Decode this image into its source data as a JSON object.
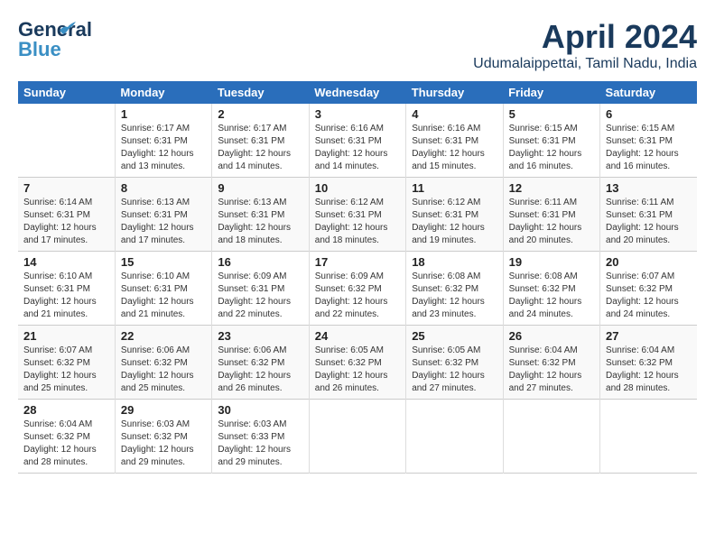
{
  "header": {
    "logo_general": "General",
    "logo_blue": "Blue",
    "month_title": "April 2024",
    "location": "Udumalaippettai, Tamil Nadu, India"
  },
  "weekdays": [
    "Sunday",
    "Monday",
    "Tuesday",
    "Wednesday",
    "Thursday",
    "Friday",
    "Saturday"
  ],
  "weeks": [
    [
      {
        "day": "",
        "info": ""
      },
      {
        "day": "1",
        "info": "Sunrise: 6:17 AM\nSunset: 6:31 PM\nDaylight: 12 hours\nand 13 minutes."
      },
      {
        "day": "2",
        "info": "Sunrise: 6:17 AM\nSunset: 6:31 PM\nDaylight: 12 hours\nand 14 minutes."
      },
      {
        "day": "3",
        "info": "Sunrise: 6:16 AM\nSunset: 6:31 PM\nDaylight: 12 hours\nand 14 minutes."
      },
      {
        "day": "4",
        "info": "Sunrise: 6:16 AM\nSunset: 6:31 PM\nDaylight: 12 hours\nand 15 minutes."
      },
      {
        "day": "5",
        "info": "Sunrise: 6:15 AM\nSunset: 6:31 PM\nDaylight: 12 hours\nand 16 minutes."
      },
      {
        "day": "6",
        "info": "Sunrise: 6:15 AM\nSunset: 6:31 PM\nDaylight: 12 hours\nand 16 minutes."
      }
    ],
    [
      {
        "day": "7",
        "info": "Sunrise: 6:14 AM\nSunset: 6:31 PM\nDaylight: 12 hours\nand 17 minutes."
      },
      {
        "day": "8",
        "info": "Sunrise: 6:13 AM\nSunset: 6:31 PM\nDaylight: 12 hours\nand 17 minutes."
      },
      {
        "day": "9",
        "info": "Sunrise: 6:13 AM\nSunset: 6:31 PM\nDaylight: 12 hours\nand 18 minutes."
      },
      {
        "day": "10",
        "info": "Sunrise: 6:12 AM\nSunset: 6:31 PM\nDaylight: 12 hours\nand 18 minutes."
      },
      {
        "day": "11",
        "info": "Sunrise: 6:12 AM\nSunset: 6:31 PM\nDaylight: 12 hours\nand 19 minutes."
      },
      {
        "day": "12",
        "info": "Sunrise: 6:11 AM\nSunset: 6:31 PM\nDaylight: 12 hours\nand 20 minutes."
      },
      {
        "day": "13",
        "info": "Sunrise: 6:11 AM\nSunset: 6:31 PM\nDaylight: 12 hours\nand 20 minutes."
      }
    ],
    [
      {
        "day": "14",
        "info": "Sunrise: 6:10 AM\nSunset: 6:31 PM\nDaylight: 12 hours\nand 21 minutes."
      },
      {
        "day": "15",
        "info": "Sunrise: 6:10 AM\nSunset: 6:31 PM\nDaylight: 12 hours\nand 21 minutes."
      },
      {
        "day": "16",
        "info": "Sunrise: 6:09 AM\nSunset: 6:31 PM\nDaylight: 12 hours\nand 22 minutes."
      },
      {
        "day": "17",
        "info": "Sunrise: 6:09 AM\nSunset: 6:32 PM\nDaylight: 12 hours\nand 22 minutes."
      },
      {
        "day": "18",
        "info": "Sunrise: 6:08 AM\nSunset: 6:32 PM\nDaylight: 12 hours\nand 23 minutes."
      },
      {
        "day": "19",
        "info": "Sunrise: 6:08 AM\nSunset: 6:32 PM\nDaylight: 12 hours\nand 24 minutes."
      },
      {
        "day": "20",
        "info": "Sunrise: 6:07 AM\nSunset: 6:32 PM\nDaylight: 12 hours\nand 24 minutes."
      }
    ],
    [
      {
        "day": "21",
        "info": "Sunrise: 6:07 AM\nSunset: 6:32 PM\nDaylight: 12 hours\nand 25 minutes."
      },
      {
        "day": "22",
        "info": "Sunrise: 6:06 AM\nSunset: 6:32 PM\nDaylight: 12 hours\nand 25 minutes."
      },
      {
        "day": "23",
        "info": "Sunrise: 6:06 AM\nSunset: 6:32 PM\nDaylight: 12 hours\nand 26 minutes."
      },
      {
        "day": "24",
        "info": "Sunrise: 6:05 AM\nSunset: 6:32 PM\nDaylight: 12 hours\nand 26 minutes."
      },
      {
        "day": "25",
        "info": "Sunrise: 6:05 AM\nSunset: 6:32 PM\nDaylight: 12 hours\nand 27 minutes."
      },
      {
        "day": "26",
        "info": "Sunrise: 6:04 AM\nSunset: 6:32 PM\nDaylight: 12 hours\nand 27 minutes."
      },
      {
        "day": "27",
        "info": "Sunrise: 6:04 AM\nSunset: 6:32 PM\nDaylight: 12 hours\nand 28 minutes."
      }
    ],
    [
      {
        "day": "28",
        "info": "Sunrise: 6:04 AM\nSunset: 6:32 PM\nDaylight: 12 hours\nand 28 minutes."
      },
      {
        "day": "29",
        "info": "Sunrise: 6:03 AM\nSunset: 6:32 PM\nDaylight: 12 hours\nand 29 minutes."
      },
      {
        "day": "30",
        "info": "Sunrise: 6:03 AM\nSunset: 6:33 PM\nDaylight: 12 hours\nand 29 minutes."
      },
      {
        "day": "",
        "info": ""
      },
      {
        "day": "",
        "info": ""
      },
      {
        "day": "",
        "info": ""
      },
      {
        "day": "",
        "info": ""
      }
    ]
  ]
}
